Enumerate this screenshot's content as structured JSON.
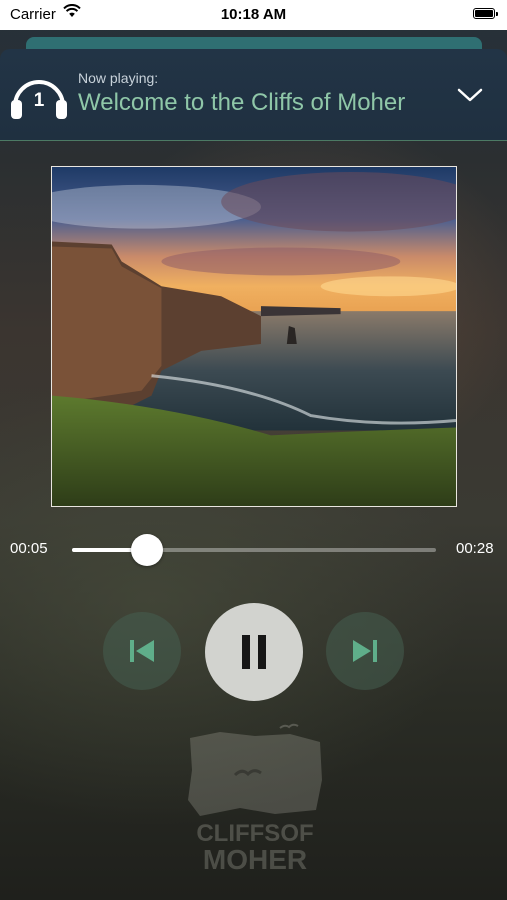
{
  "status_bar": {
    "carrier": "Carrier",
    "time": "10:18 AM"
  },
  "header": {
    "track_number": "1",
    "now_label": "Now playing:",
    "title": "Welcome to the Cliffs of Moher",
    "collapse_icon": "chevron-down-icon",
    "title_color": "#8fc7a8"
  },
  "player": {
    "elapsed": "00:05",
    "total": "00:28",
    "progress_fraction": 0.205,
    "prev_icon": "skip-previous-icon",
    "play_state_icon": "pause-icon",
    "next_icon": "skip-next-icon"
  },
  "logo": {
    "line1": "CLIFFSOF",
    "line2": "MOHER"
  }
}
